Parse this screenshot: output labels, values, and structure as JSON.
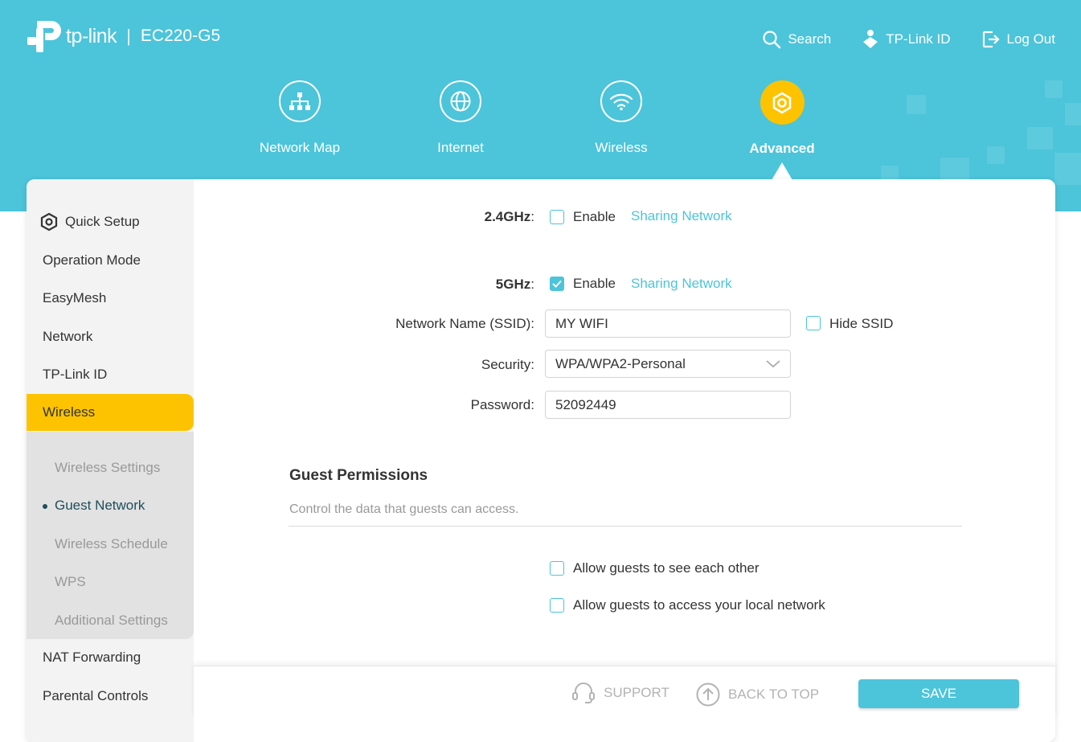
{
  "header": {
    "brand": "tp-link",
    "model": "EC220-G5",
    "links": [
      {
        "label": "Search",
        "icon": "search-icon"
      },
      {
        "label": "TP-Link ID",
        "icon": "tplink-id-icon"
      },
      {
        "label": "Log Out",
        "icon": "logout-icon"
      }
    ]
  },
  "nav": [
    {
      "label": "Network Map",
      "icon": "network-map-icon"
    },
    {
      "label": "Internet",
      "icon": "globe-icon"
    },
    {
      "label": "Wireless",
      "icon": "wifi-icon"
    },
    {
      "label": "Advanced",
      "icon": "gear-icon",
      "active": true
    }
  ],
  "sidebar": {
    "items": [
      {
        "label": "Quick Setup"
      },
      {
        "label": "Operation Mode"
      },
      {
        "label": "EasyMesh"
      },
      {
        "label": "Network"
      },
      {
        "label": "TP-Link ID"
      },
      {
        "label": "Wireless",
        "active": true
      },
      {
        "label": "NAT Forwarding"
      },
      {
        "label": "Parental Controls"
      }
    ],
    "sub_items": [
      {
        "label": "Wireless Settings"
      },
      {
        "label": "Guest Network",
        "current": true
      },
      {
        "label": "Wireless Schedule"
      },
      {
        "label": "WPS"
      },
      {
        "label": "Additional Settings"
      }
    ]
  },
  "band24": {
    "label": "2.4GHz",
    "colon": ":",
    "enable_label": "Enable",
    "enabled": false,
    "sharing_link": "Sharing Network"
  },
  "band5": {
    "label": "5GHz",
    "colon": ":",
    "enable_label": "Enable",
    "enabled": true,
    "sharing_link": "Sharing Network",
    "ssid_label": "Network Name (SSID):",
    "ssid_value": "MY WIFI",
    "hide_ssid_label": "Hide SSID",
    "hide_ssid_checked": false,
    "security_label": "Security:",
    "security_value": "WPA/WPA2-Personal",
    "password_label": "Password:",
    "password_value": "52092449"
  },
  "guest": {
    "title": "Guest Permissions",
    "description": "Control the data that guests can access.",
    "options": [
      {
        "label": "Allow guests to see each other",
        "checked": false
      },
      {
        "label": "Allow guests to access your local network",
        "checked": false
      }
    ]
  },
  "footer": {
    "support_label": "SUPPORT",
    "back_to_top_label": "BACK TO TOP",
    "save_label": "SAVE"
  },
  "colors": {
    "accent": "#4cc4da",
    "active": "#fdc300"
  }
}
